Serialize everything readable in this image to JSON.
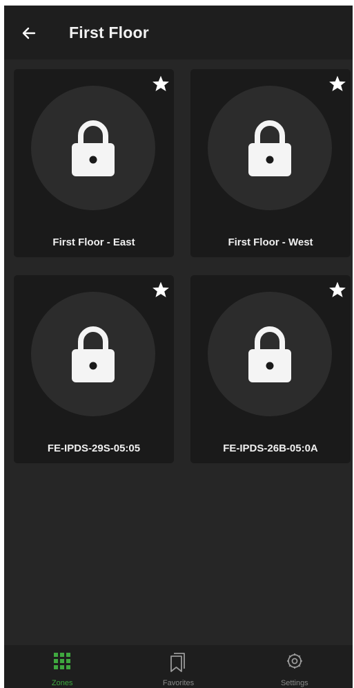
{
  "header": {
    "title": "First Floor",
    "back_icon": "arrow-left-icon"
  },
  "zones": [
    {
      "name": "First Floor - East",
      "icon": "lock-icon",
      "favorite": true
    },
    {
      "name": "First Floor - West",
      "icon": "lock-icon",
      "favorite": true
    },
    {
      "name": "FE-IPDS-29S-05:05",
      "icon": "lock-icon",
      "favorite": true
    },
    {
      "name": "FE-IPDS-26B-05:0A",
      "icon": "lock-icon",
      "favorite": true
    }
  ],
  "bottom_nav": {
    "items": [
      {
        "label": "Zones",
        "icon": "grid-icon",
        "active": true
      },
      {
        "label": "Favorites",
        "icon": "bookmark-icon",
        "active": false
      },
      {
        "label": "Settings",
        "icon": "gear-icon",
        "active": false
      }
    ]
  },
  "colors": {
    "accent": "#3fa83f",
    "background": "#262626",
    "card": "#1a1a1a",
    "circle": "#2c2c2c"
  }
}
